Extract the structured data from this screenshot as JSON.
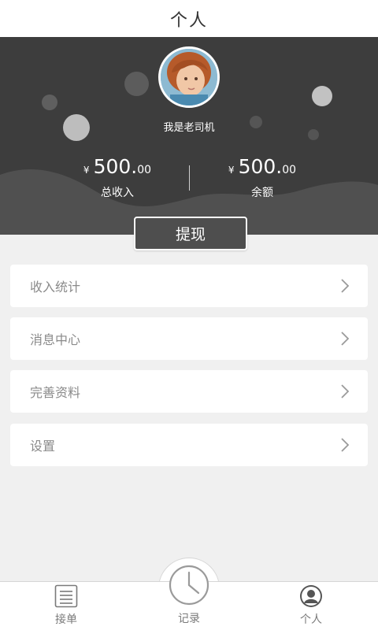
{
  "header": {
    "title": "个人"
  },
  "profile": {
    "nickname": "我是老司机",
    "avatar_icon": "child-portrait-avatar"
  },
  "stats": {
    "total_income": {
      "currency": "¥",
      "integer": "500.",
      "decimal": "00",
      "label": "总收入"
    },
    "balance": {
      "currency": "¥",
      "integer": "500.",
      "decimal": "00",
      "label": "余额"
    }
  },
  "withdraw_label": "提现",
  "menu": [
    {
      "label": "收入统计",
      "icon": "chevron-right-icon"
    },
    {
      "label": "消息中心",
      "icon": "chevron-right-icon"
    },
    {
      "label": "完善资料",
      "icon": "chevron-right-icon"
    },
    {
      "label": "设置",
      "icon": "chevron-right-icon"
    }
  ],
  "tabbar": {
    "orders": {
      "label": "接单",
      "icon": "list-icon"
    },
    "records": {
      "label": "记录",
      "icon": "clock-icon"
    },
    "profile": {
      "label": "个人",
      "icon": "user-icon"
    }
  },
  "colors": {
    "hero_bg": "#3d3d3d",
    "page_bg": "#f0f0f0",
    "button_bg": "#4e4e4e"
  }
}
